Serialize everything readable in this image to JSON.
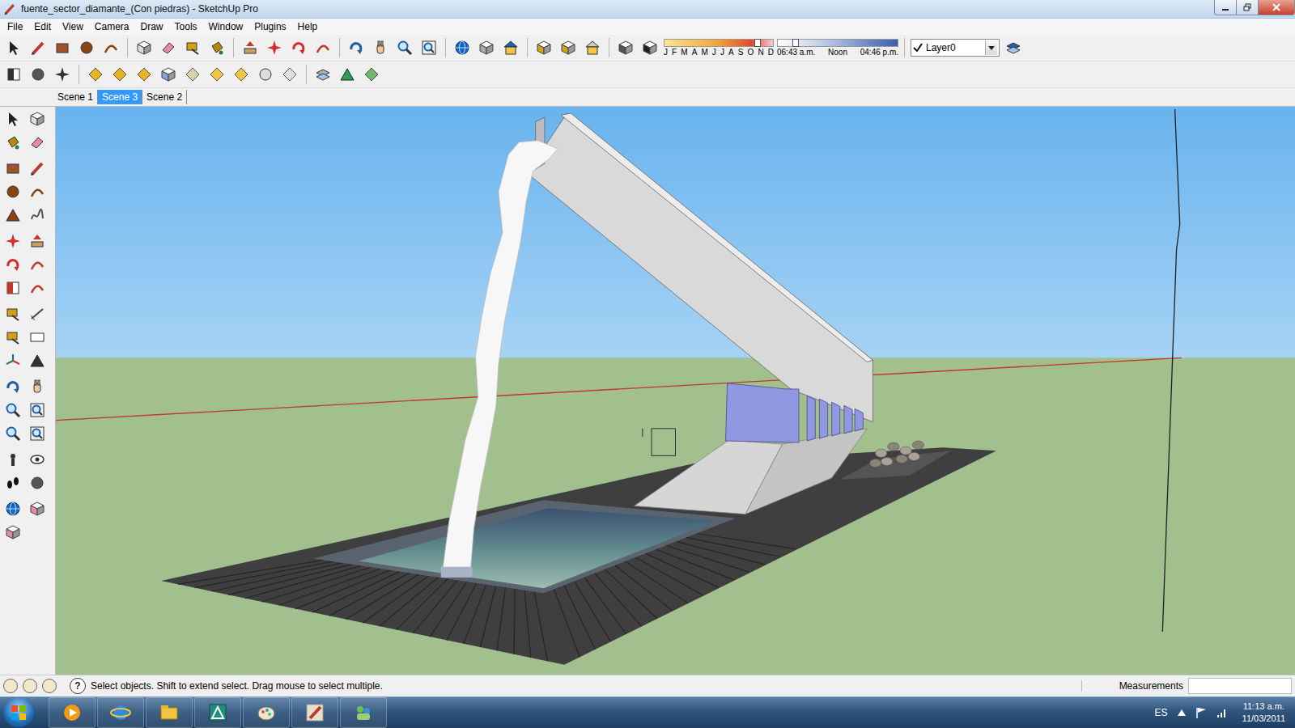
{
  "window": {
    "title": "fuente_sector_diamante_(Con piedras) - SketchUp Pro"
  },
  "menu": [
    "File",
    "Edit",
    "View",
    "Camera",
    "Draw",
    "Tools",
    "Window",
    "Plugins",
    "Help"
  ],
  "shadows": {
    "months": [
      "J",
      "F",
      "M",
      "A",
      "M",
      "J",
      "J",
      "A",
      "S",
      "O",
      "N",
      "D"
    ],
    "date_level": 0.86,
    "times": [
      "06:43 a.m.",
      "Noon",
      "04:46 p.m."
    ],
    "time_level": 0.15
  },
  "layer": {
    "name": "Layer0",
    "checked": true
  },
  "scenes": [
    {
      "label": "Scene 1",
      "selected": false
    },
    {
      "label": "Scene 3",
      "selected": true
    },
    {
      "label": "Scene 2",
      "selected": false
    }
  ],
  "status_bar": {
    "help_glyph": "?",
    "hint": "Select objects. Shift to extend select. Drag mouse to select multiple.",
    "measurements_label": "Measurements"
  },
  "taskbar": {
    "language": "ES",
    "time": "11:13 a.m.",
    "date": "11/03/2011"
  }
}
